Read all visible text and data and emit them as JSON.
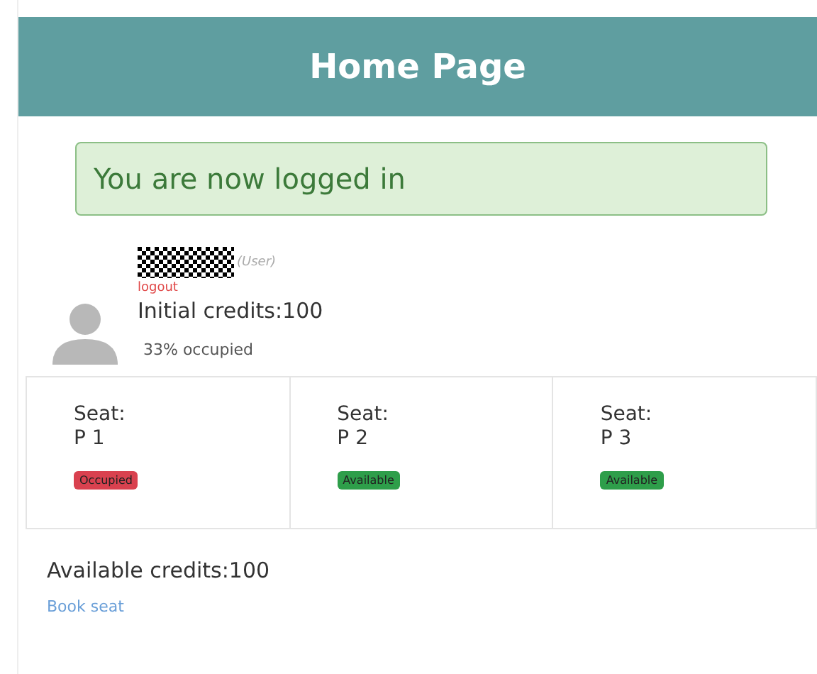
{
  "header": {
    "title": "Home Page"
  },
  "alert": {
    "text": "You are now logged in"
  },
  "user": {
    "role": "(User)",
    "logout": "logout",
    "initial_credits": "Initial credits:100",
    "occupancy": "33% occupied"
  },
  "seats": [
    {
      "label": "Seat:",
      "name": "P 1",
      "kind": "occupied",
      "badge": "Occupied"
    },
    {
      "label": "Seat:",
      "name": "P 2",
      "kind": "available",
      "badge": "Available"
    },
    {
      "label": "Seat:",
      "name": "P 3",
      "kind": "available",
      "badge": "Available"
    }
  ],
  "footer": {
    "available_credits": "Available credits:100",
    "book_link": "Book seat"
  }
}
